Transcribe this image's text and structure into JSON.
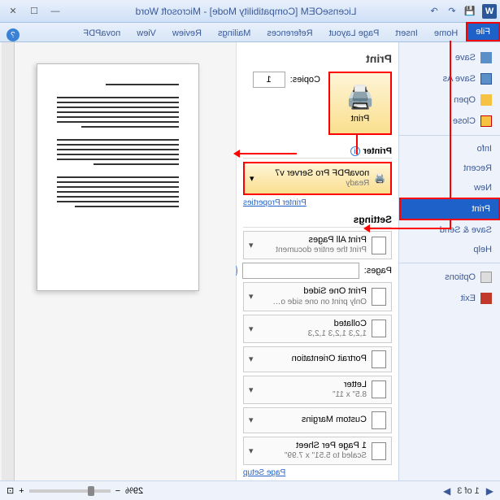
{
  "title": "LicenseOEM [Compatibility Mode] - Microsoft Word",
  "tabs": {
    "file": "File",
    "home": "Home",
    "insert": "Insert",
    "pagelayout": "Page Layout",
    "references": "References",
    "mailings": "Mailings",
    "review": "Review",
    "view": "View",
    "novapdf": "novaPDF"
  },
  "sidebar": {
    "save": "Save",
    "saveas": "Save As",
    "open": "Open",
    "close": "Close",
    "info": "Info",
    "recent": "Recent",
    "new": "New",
    "print": "Print",
    "savesend": "Save & Send",
    "help": "Help",
    "options": "Options",
    "exit": "Exit"
  },
  "print": {
    "title": "Print",
    "button": "Print",
    "copies_label": "Copies:",
    "copies_value": "1",
    "printer_header": "Printer",
    "printer_name": "novaPDF Pro Server v7",
    "printer_status": "Ready",
    "printer_props": "Printer Properties",
    "settings_header": "Settings",
    "opts": [
      {
        "t": "Print All Pages",
        "s": "Print the entire document"
      },
      {
        "t": "Print One Sided",
        "s": "Only print on one side o…"
      },
      {
        "t": "Collated",
        "s": "1,2,3   1,2,3   1,2,3"
      },
      {
        "t": "Portrait Orientation",
        "s": ""
      },
      {
        "t": "Letter",
        "s": "8.5\" x 11\""
      },
      {
        "t": "Custom Margins",
        "s": ""
      },
      {
        "t": "1 Page Per Sheet",
        "s": "Scaled to 5.51\" x 7.99\""
      }
    ],
    "pages_label": "Pages:",
    "page_setup": "Page Setup"
  },
  "status": {
    "page": "1",
    "of_label": "of",
    "total": "3",
    "zoom": "29%"
  }
}
